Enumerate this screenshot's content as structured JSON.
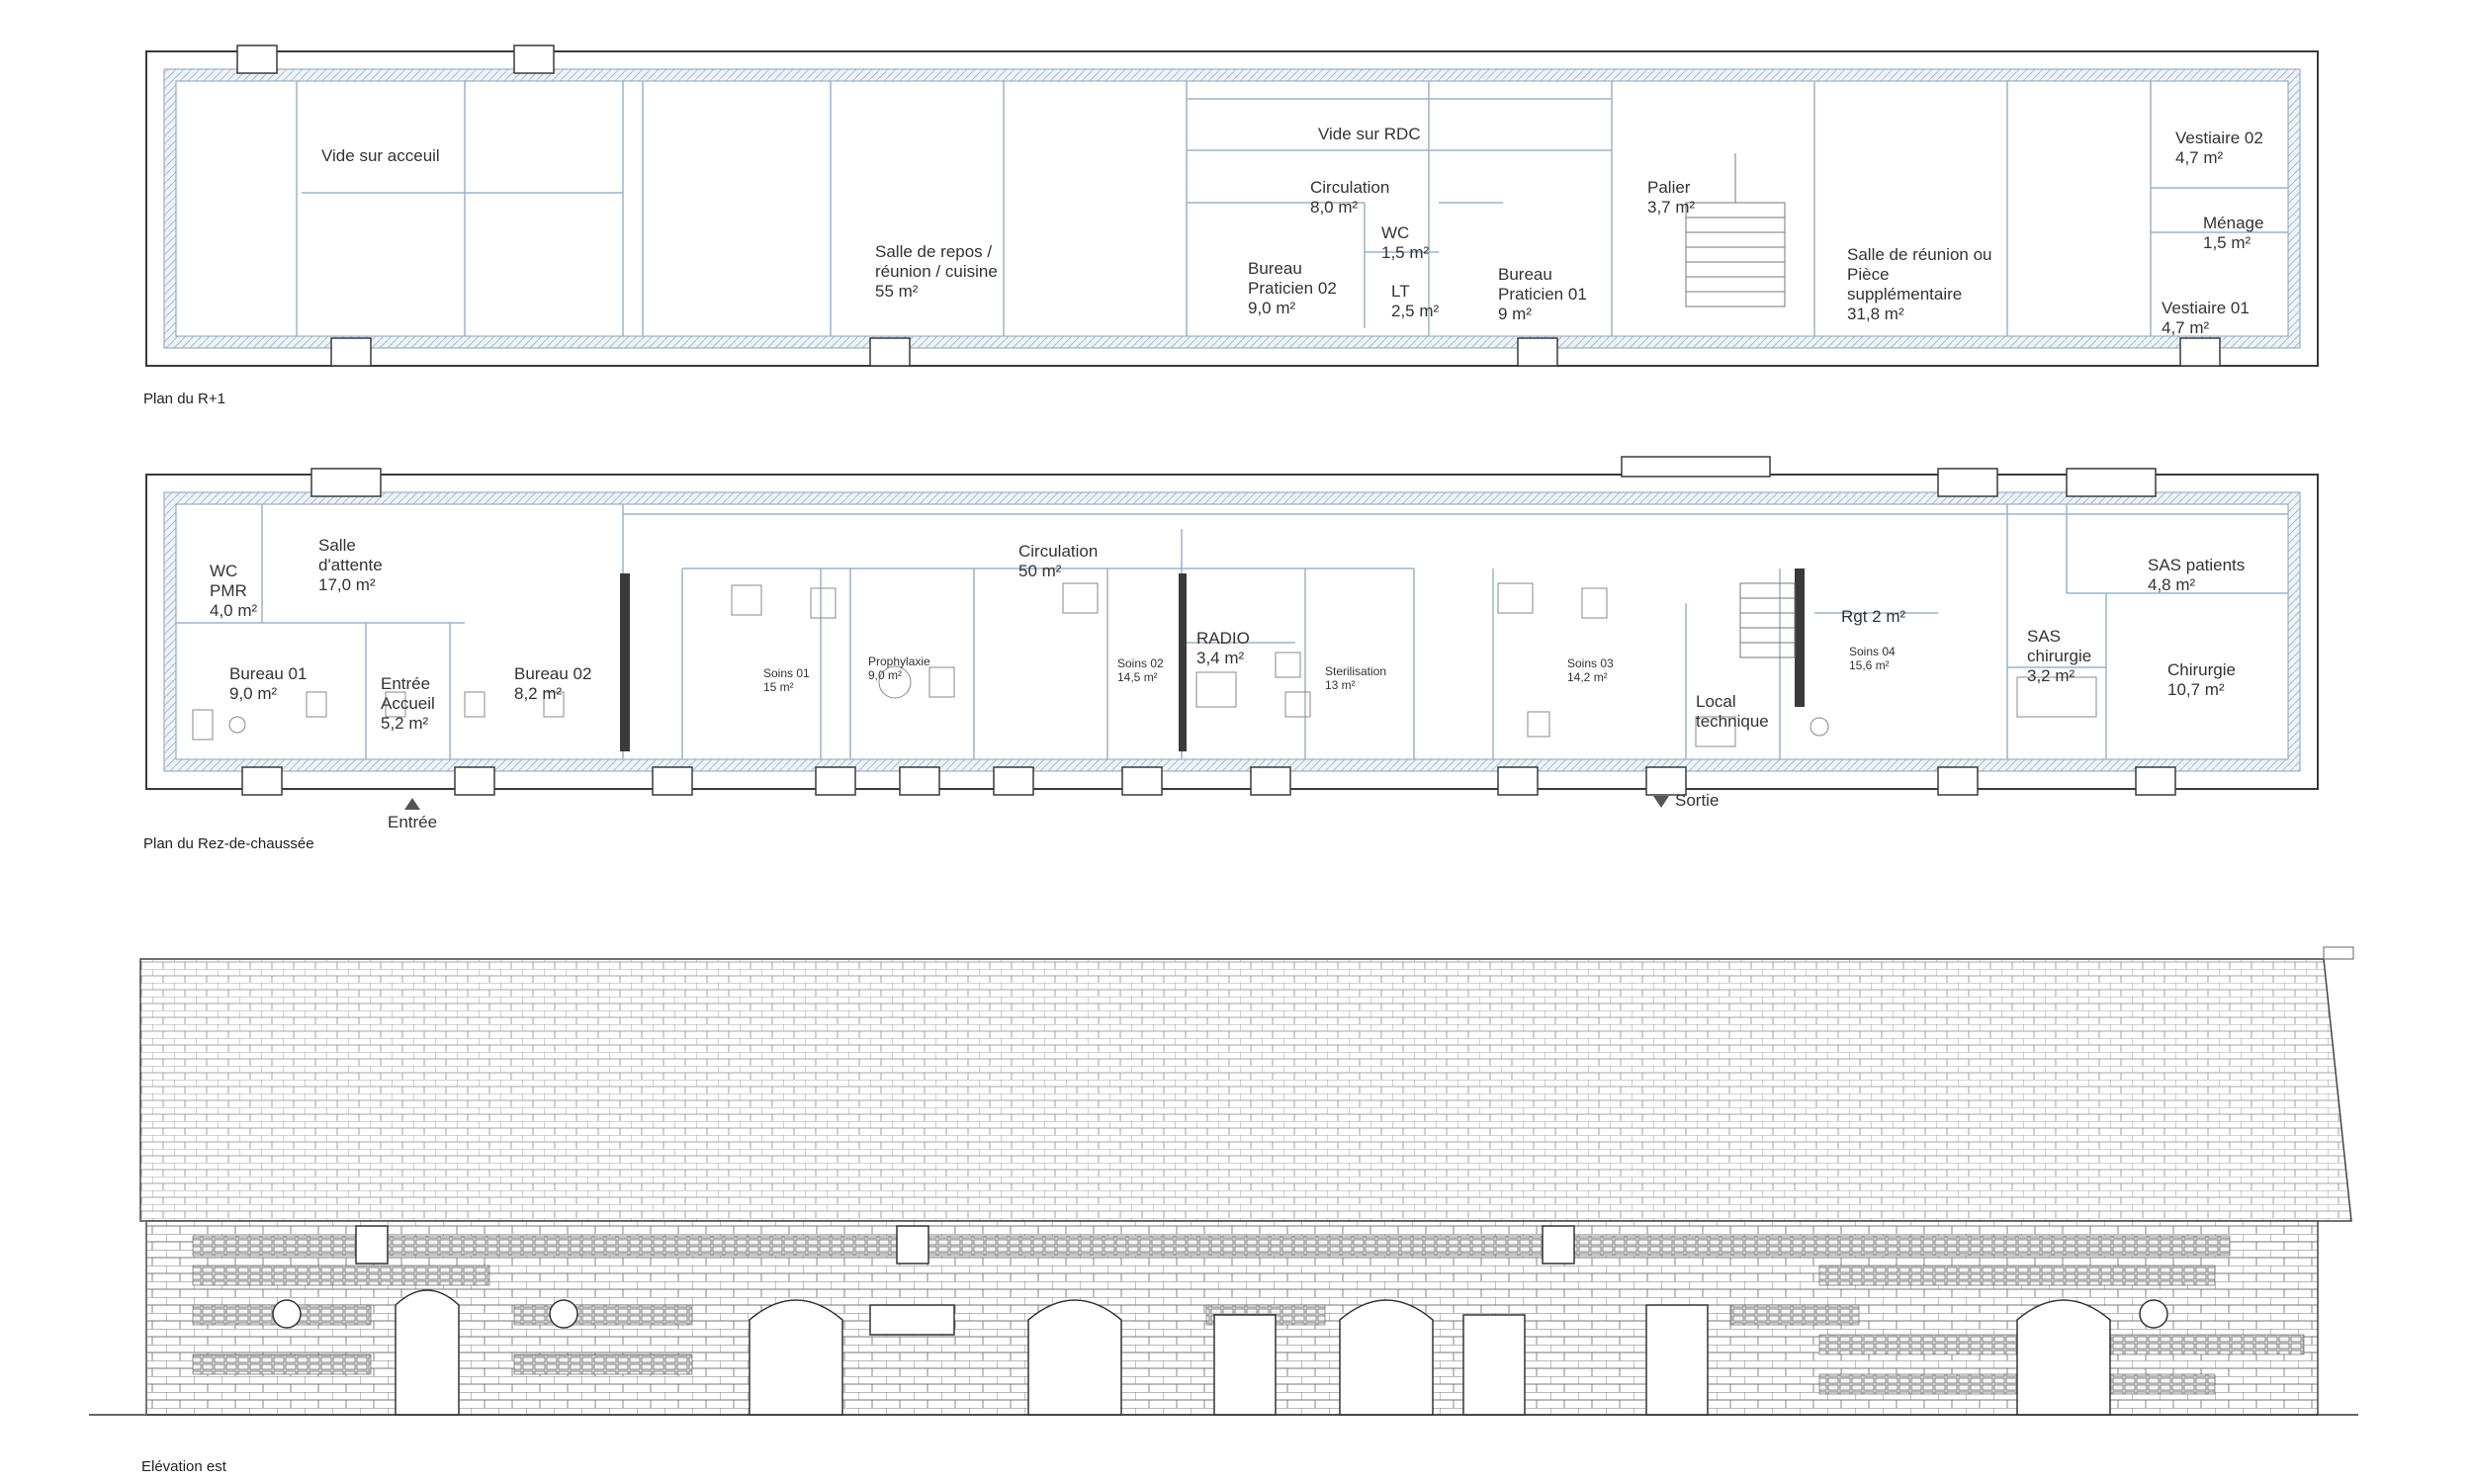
{
  "plans": {
    "upper": {
      "caption": "Plan du R+1",
      "rooms": [
        {
          "id": "vide-accueil",
          "name": "Vide sur acceuil",
          "area": ""
        },
        {
          "id": "salle-repos",
          "name": "Salle de repos /\nréunion / cuisine",
          "area": "55 m²"
        },
        {
          "id": "vide-rdc",
          "name": "Vide sur RDC",
          "area": ""
        },
        {
          "id": "circulation-r1",
          "name": "Circulation",
          "area": "8,0 m²"
        },
        {
          "id": "wc-r1",
          "name": "WC",
          "area": "1,5 m²"
        },
        {
          "id": "lt",
          "name": "LT",
          "area": "2,5 m²"
        },
        {
          "id": "bureau-praticien-02",
          "name": "Bureau\nPraticien 02",
          "area": "9,0 m²"
        },
        {
          "id": "bureau-praticien-01",
          "name": "Bureau\nPraticien 01",
          "area": "9 m²"
        },
        {
          "id": "palier",
          "name": "Palier",
          "area": "3,7 m²"
        },
        {
          "id": "salle-reunion",
          "name": "Salle de réunion ou\nPièce\nsupplémentaire",
          "area": "31,8 m²"
        },
        {
          "id": "vestiaire-02",
          "name": "Vestiaire 02",
          "area": "4,7 m²"
        },
        {
          "id": "menage",
          "name": "Ménage",
          "area": "1,5 m²"
        },
        {
          "id": "vestiaire-01",
          "name": "Vestiaire 01",
          "area": "4,7 m²"
        }
      ]
    },
    "ground": {
      "caption": "Plan du Rez-de-chaussée",
      "rooms": [
        {
          "id": "wc-pmr",
          "name": "WC\nPMR",
          "area": "4,0 m²"
        },
        {
          "id": "salle-attente",
          "name": "Salle\nd'attente",
          "area": "17,0 m²"
        },
        {
          "id": "bureau-01",
          "name": "Bureau 01",
          "area": "9,0 m²"
        },
        {
          "id": "entree-accueil",
          "name": "Entrée\nAccueil",
          "area": "5,2 m²"
        },
        {
          "id": "bureau-02",
          "name": "Bureau 02",
          "area": "8,2 m²"
        },
        {
          "id": "soins-01",
          "name": "Soins 01",
          "area": "15 m²"
        },
        {
          "id": "prophylaxie",
          "name": "Prophylaxie",
          "area": "9,0 m²"
        },
        {
          "id": "circulation-rdc",
          "name": "Circulation",
          "area": "50 m²"
        },
        {
          "id": "soins-02",
          "name": "Soins 02",
          "area": "14,5 m²"
        },
        {
          "id": "radio",
          "name": "RADIO",
          "area": "3,4 m²"
        },
        {
          "id": "sterilisation",
          "name": "Sterilisation",
          "area": "13 m²"
        },
        {
          "id": "soins-03",
          "name": "Soins 03",
          "area": "14,2 m²"
        },
        {
          "id": "local-technique",
          "name": "Local\ntechnique",
          "area": ""
        },
        {
          "id": "rgt",
          "name": "Rgt 2 m²",
          "area": ""
        },
        {
          "id": "soins-04",
          "name": "Soins 04",
          "area": "15,6 m²"
        },
        {
          "id": "sas-patients",
          "name": "SAS patients",
          "area": "4,8 m²"
        },
        {
          "id": "sas-chirurgie",
          "name": "SAS\nchirurgie",
          "area": "3,2 m²"
        },
        {
          "id": "chirurgie",
          "name": "Chirurgie",
          "area": "10,7 m²"
        }
      ],
      "markers": {
        "entree": "Entrée",
        "sortie": "Sortie"
      }
    }
  },
  "elevation": {
    "caption": "Elévation est"
  },
  "colors": {
    "wall": "#3a3a3a",
    "partition": "#9bb3c8",
    "insulation": "#b8c8d8",
    "ink": "#333333"
  }
}
